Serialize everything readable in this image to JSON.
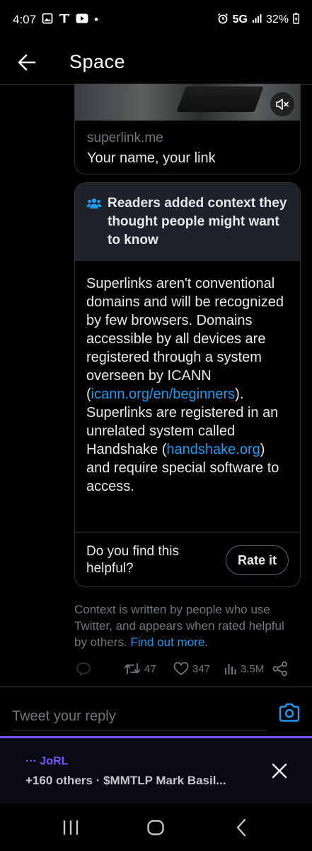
{
  "status_bar": {
    "time": "4:07",
    "dot": "•",
    "network": "5G",
    "battery": "32%",
    "icons": [
      "gallery-icon",
      "t-mobile-icon",
      "youtube-icon",
      "alarm-icon",
      "signal-icon",
      "battery-icon"
    ]
  },
  "header": {
    "title": "Space",
    "back_icon": "arrow-left-icon"
  },
  "link_card": {
    "domain": "superlink.me",
    "description": "Your name, your link",
    "mute_icon": "volume-mute-icon"
  },
  "community_note": {
    "heading": "Readers added context they thought people might want to know",
    "heading_icon": "people-icon",
    "body_part1": "Superlinks aren't conventional domains and will be recognized by few browsers. Domains accessible by all devices are registered through a system overseen by ICANN (",
    "link1": "icann.org/en/beginners",
    "body_part2": "). Superlinks are registered in an unrelated system called Handshake (",
    "link2": "handshake.org",
    "body_part3": ") and require special software to access.",
    "question": "Do you find this helpful?",
    "rate_label": "Rate it"
  },
  "context_info": {
    "text": "Context is written by people who use Twitter, and appears when rated helpful by others.",
    "link": "Find out more."
  },
  "actions": {
    "retweets": "47",
    "likes": "347",
    "views": "3.5M"
  },
  "reply": {
    "placeholder": "Tweet your reply"
  },
  "space_bar": {
    "host": "··· JoRL",
    "description": "+160 others · $MMTLP Mark Basil..."
  },
  "colors": {
    "accent_blue": "#1d9bf0",
    "space_purple": "#7856ff",
    "note_header_bg": "#1d2329",
    "muted_text": "#71767b"
  }
}
